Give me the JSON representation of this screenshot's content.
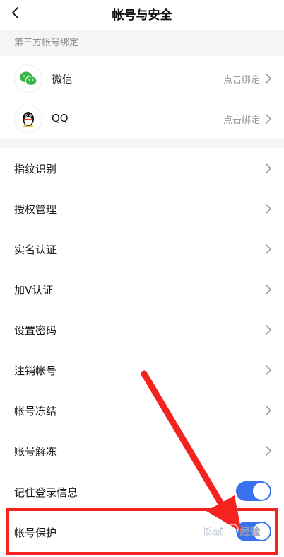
{
  "header": {
    "title": "帐号与安全",
    "back_icon": "chevron-left-icon"
  },
  "third_party": {
    "section_title": "第三方帐号绑定",
    "items": [
      {
        "label": "微信",
        "action": "点击绑定",
        "icon": "wechat-icon",
        "color": "#39b54a"
      },
      {
        "label": "QQ",
        "action": "点击绑定",
        "icon": "qq-penguin-icon",
        "color": "#000000"
      }
    ]
  },
  "settings": {
    "items": [
      {
        "label": "指纹识别"
      },
      {
        "label": "授权管理"
      },
      {
        "label": "实名认证"
      },
      {
        "label": "加V认证"
      },
      {
        "label": "设置密码"
      },
      {
        "label": "注销帐号"
      },
      {
        "label": "帐号冻结"
      },
      {
        "label": "账号解冻"
      }
    ],
    "toggles": [
      {
        "label": "记住登录信息",
        "on": true
      },
      {
        "label": "帐号保护",
        "on": true
      }
    ]
  },
  "colors": {
    "accent": "#3a71ef",
    "annotation": "#f5231f",
    "section_bg": "#f5f5f7"
  },
  "annotation": {
    "type": "red-arrow-and-box",
    "target": "帐号保护"
  },
  "watermark": {
    "text": "Bai经验"
  }
}
